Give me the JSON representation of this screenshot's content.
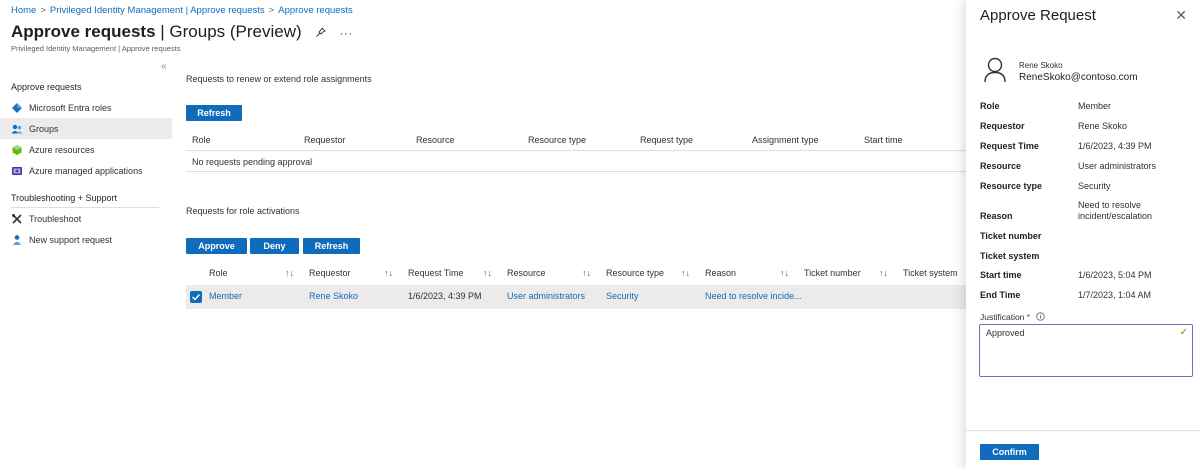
{
  "breadcrumb": {
    "items": [
      "Home",
      "Privileged Identity Management | Approve requests",
      "Approve requests"
    ],
    "separator": ">"
  },
  "page": {
    "title_bold": "Approve requests",
    "title_rest": "| Groups (Preview)",
    "subtitle": "Privileged Identity Management | Approve requests",
    "pin_icon": "pin-icon",
    "more_icon": "ellipsis-icon",
    "collapse_glyph": "«"
  },
  "sidebar": {
    "heading": "Approve requests",
    "items": [
      {
        "label": "Microsoft Entra roles",
        "icon": "entra-roles-icon"
      },
      {
        "label": "Groups",
        "icon": "groups-icon",
        "active": true
      },
      {
        "label": "Azure resources",
        "icon": "azure-resources-icon"
      },
      {
        "label": "Azure managed applications",
        "icon": "managed-apps-icon"
      }
    ],
    "section2_heading": "Troubleshooting + Support",
    "section2_items": [
      {
        "label": "Troubleshoot",
        "icon": "troubleshoot-icon"
      },
      {
        "label": "New support request",
        "icon": "support-request-icon"
      }
    ]
  },
  "renew": {
    "label": "Requests to renew or extend role assignments",
    "refresh_label": "Refresh",
    "columns": [
      "Role",
      "Requestor",
      "Resource",
      "Resource type",
      "Request type",
      "Assignment type",
      "Start time"
    ],
    "empty_text": "No requests pending approval"
  },
  "activations": {
    "label": "Requests for role activations",
    "approve_label": "Approve",
    "deny_label": "Deny",
    "refresh_label": "Refresh",
    "columns": [
      "Role",
      "Requestor",
      "Request Time",
      "Resource",
      "Resource type",
      "Reason",
      "Ticket number",
      "Ticket system"
    ],
    "sort_glyph": "↑↓",
    "rows": [
      {
        "selected": true,
        "role": "Member",
        "requestor": "Rene Skoko",
        "request_time": "1/6/2023, 4:39 PM",
        "resource": "User administrators",
        "resource_type": "Security",
        "reason": "Need to resolve incide..."
      }
    ]
  },
  "panel": {
    "title": "Approve Request",
    "close_glyph": "✕",
    "user_name": "Rene Skoko",
    "user_email": "ReneSkoko@contoso.com",
    "fields": [
      {
        "label": "Role",
        "value": "Member"
      },
      {
        "label": "Requestor",
        "value": "Rene Skoko"
      },
      {
        "label": "Request Time",
        "value": "1/6/2023, 4:39 PM"
      },
      {
        "label": "Resource",
        "value": "User administrators"
      },
      {
        "label": "Resource type",
        "value": "Security"
      },
      {
        "label": "Reason",
        "value_line1": "Need to resolve",
        "value_line2": "incident/escalation"
      },
      {
        "label": "Ticket number",
        "value": ""
      },
      {
        "label": "Ticket system",
        "value": ""
      },
      {
        "label": "Start time",
        "value": "1/6/2023, 5:04 PM"
      },
      {
        "label": "End Time",
        "value": "1/7/2023, 1:04 AM"
      }
    ],
    "justification_label": "Justification",
    "required_mark": "*",
    "info_icon": "info-icon",
    "justification_value": "Approved",
    "confirm_label": "Confirm"
  },
  "colors": {
    "accent": "#0f6cbd",
    "selected_row": "#edebe9",
    "textarea_border": "#8764b8",
    "valid_check": "#57a300"
  }
}
